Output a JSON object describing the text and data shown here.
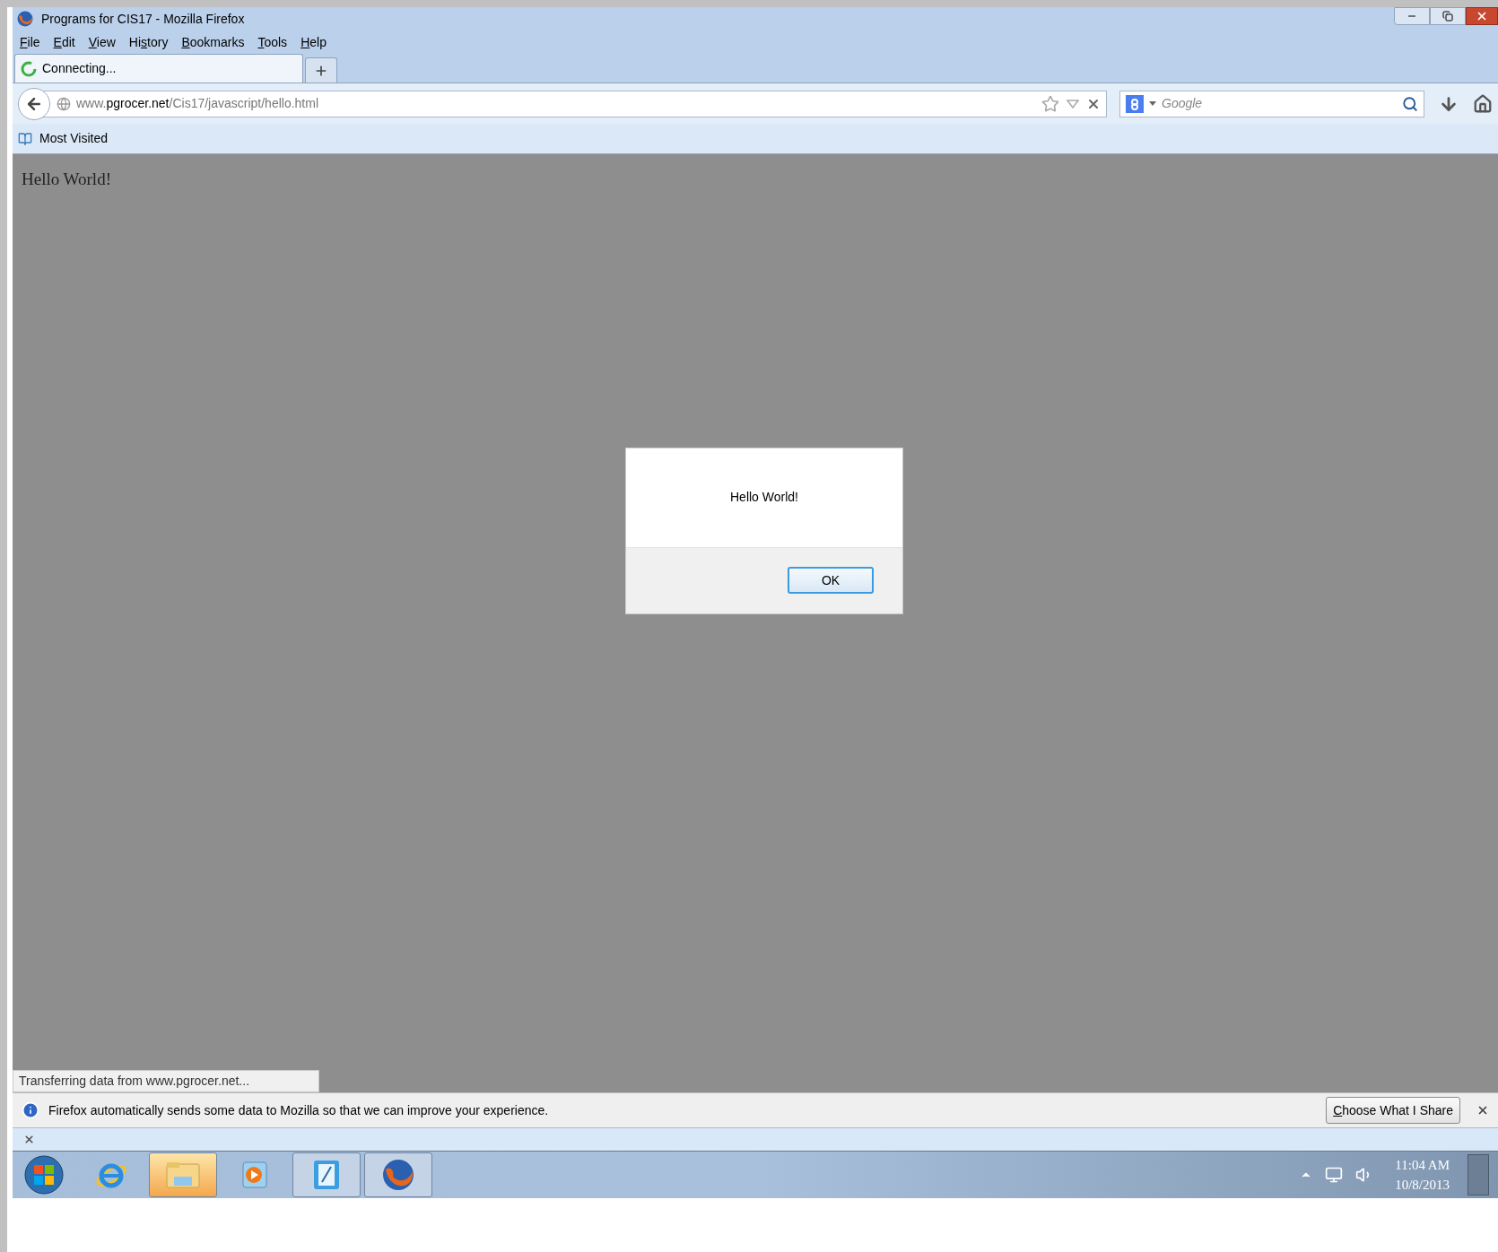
{
  "window": {
    "title": "Programs for CIS17 - Mozilla Firefox"
  },
  "menu": [
    {
      "key": "F",
      "after": "ile"
    },
    {
      "key": "E",
      "after": "dit"
    },
    {
      "key": "V",
      "after": "iew"
    },
    {
      "before": "Hi",
      "key": "s",
      "after": "tory"
    },
    {
      "key": "B",
      "after": "ookmarks"
    },
    {
      "key": "T",
      "after": "ools"
    },
    {
      "key": "H",
      "after": "elp"
    }
  ],
  "tabs": [
    {
      "label": "Connecting...",
      "selected": true,
      "loading": true
    }
  ],
  "address_bar": {
    "value": "www.**pgrocer.net**/Cis17/javascript/hello.html"
  },
  "search": {
    "placeholder": "Google"
  },
  "bookmarks": [
    {
      "label": "Most Visited"
    }
  ],
  "page": {
    "text": "Hello World!"
  },
  "dialog": {
    "message": "Hello World!",
    "button": "OK"
  },
  "status": "Transferring data from www.pgrocer.net...",
  "notification": {
    "message": "Firefox automatically sends some data to Mozilla so that we can improve your experience.",
    "button": {
      "key": "C",
      "after": "hoose What I Share"
    }
  },
  "taskbar": {
    "apps": [
      {
        "kind": "ie",
        "open": false,
        "highlighted": false
      },
      {
        "kind": "explorer",
        "open": true,
        "highlighted": true
      },
      {
        "kind": "media",
        "open": false,
        "highlighted": false
      },
      {
        "kind": "notes",
        "open": true,
        "highlighted": false
      },
      {
        "kind": "firefox",
        "open": true,
        "highlighted": false
      }
    ],
    "time": "11:04 AM",
    "date": "10/8/2013"
  }
}
